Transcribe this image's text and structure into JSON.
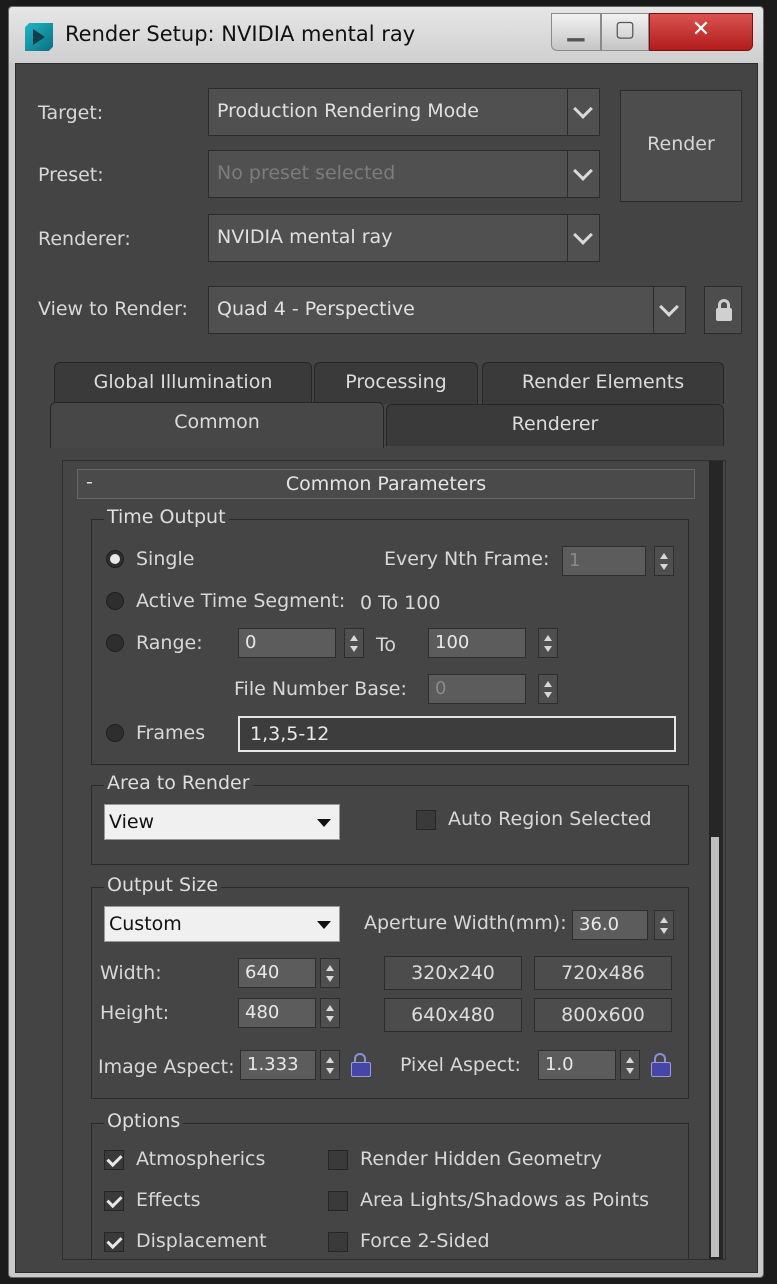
{
  "window": {
    "title": "Render Setup: NVIDIA mental ray"
  },
  "header": {
    "target_label": "Target:",
    "target_value": "Production Rendering Mode",
    "preset_label": "Preset:",
    "preset_value": "No preset selected",
    "renderer_label": "Renderer:",
    "renderer_value": "NVIDIA mental ray",
    "view_label": "View to Render:",
    "view_value": "Quad 4 - Perspective",
    "render_button": "Render"
  },
  "tabs": {
    "row1": [
      "Global Illumination",
      "Processing",
      "Render Elements"
    ],
    "row2": [
      "Common",
      "Renderer"
    ],
    "active": "Common"
  },
  "rollout": {
    "minus": "-",
    "title": "Common Parameters"
  },
  "time_output": {
    "title": "Time Output",
    "single_label": "Single",
    "every_nth_label": "Every Nth Frame:",
    "every_nth_value": "1",
    "active_segment_label": "Active Time Segment:",
    "active_segment_value": "0 To 100",
    "range_label": "Range:",
    "range_from": "0",
    "range_to_label": "To",
    "range_to": "100",
    "file_number_base_label": "File Number Base:",
    "file_number_base_value": "0",
    "frames_label": "Frames",
    "frames_value": "1,3,5-12"
  },
  "area_to_render": {
    "title": "Area to Render",
    "dropdown_value": "View",
    "auto_region_label": "Auto Region Selected"
  },
  "output_size": {
    "title": "Output Size",
    "preset_value": "Custom",
    "aperture_label": "Aperture Width(mm):",
    "aperture_value": "36.0",
    "width_label": "Width:",
    "width_value": "640",
    "height_label": "Height:",
    "height_value": "480",
    "presets": [
      "320x240",
      "720x486",
      "640x480",
      "800x600"
    ],
    "image_aspect_label": "Image Aspect:",
    "image_aspect_value": "1.333",
    "pixel_aspect_label": "Pixel Aspect:",
    "pixel_aspect_value": "1.0"
  },
  "options": {
    "title": "Options",
    "atmospherics": "Atmospherics",
    "effects": "Effects",
    "displacement": "Displacement",
    "render_hidden": "Render Hidden Geometry",
    "area_lights": "Area Lights/Shadows as Points",
    "force_two_sided": "Force 2-Sided"
  }
}
